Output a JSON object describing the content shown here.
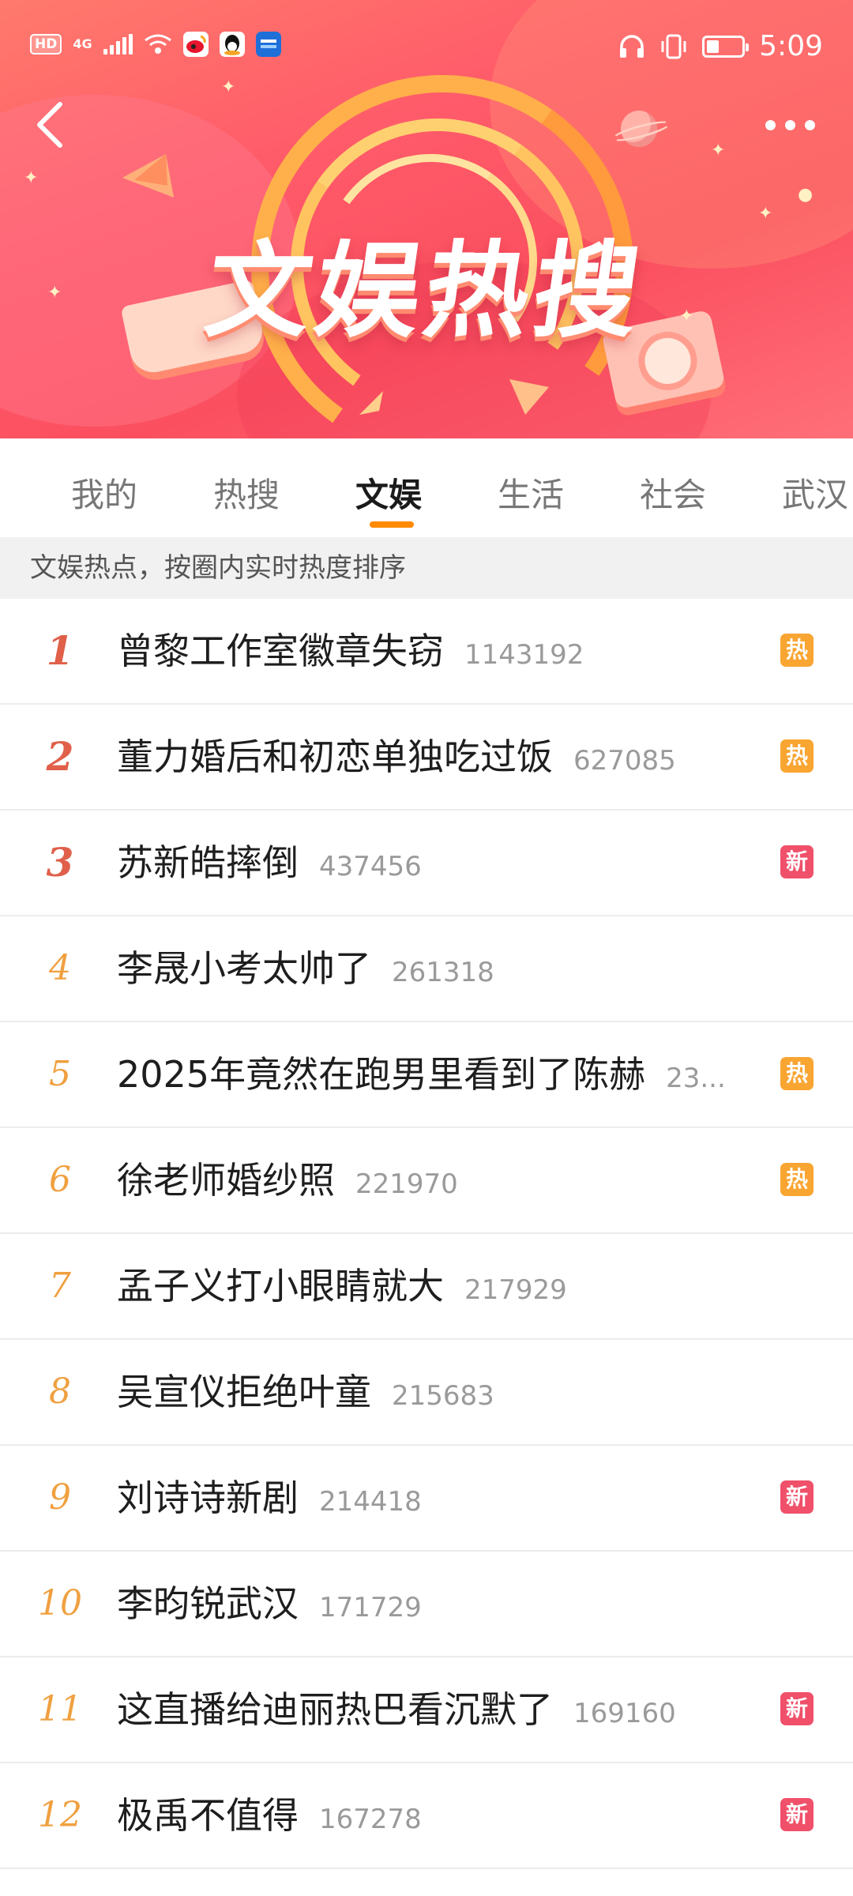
{
  "status_bar": {
    "hd": "HD",
    "network": "4G",
    "time": "5:09",
    "battery_level": 0.35
  },
  "banner": {
    "title": "文娱热搜"
  },
  "tabs": [
    {
      "label": "我的",
      "active": false
    },
    {
      "label": "热搜",
      "active": false
    },
    {
      "label": "文娱",
      "active": true
    },
    {
      "label": "生活",
      "active": false
    },
    {
      "label": "社会",
      "active": false
    },
    {
      "label": "武汉",
      "active": false
    }
  ],
  "subtitle": "文娱热点，按圈内实时热度排序",
  "items": [
    {
      "rank": "1",
      "title": "曾黎工作室徽章失窃",
      "heat": "1143192",
      "badge": "热"
    },
    {
      "rank": "2",
      "title": "董力婚后和初恋单独吃过饭",
      "heat": "627085",
      "badge": "热"
    },
    {
      "rank": "3",
      "title": "苏新皓摔倒",
      "heat": "437456",
      "badge": "新"
    },
    {
      "rank": "4",
      "title": "李晟小考太帅了",
      "heat": "261318",
      "badge": ""
    },
    {
      "rank": "5",
      "title": "2025年竟然在跑男里看到了陈赫",
      "heat": "23...",
      "badge": "热"
    },
    {
      "rank": "6",
      "title": "徐老师婚纱照",
      "heat": "221970",
      "badge": "热"
    },
    {
      "rank": "7",
      "title": "孟子义打小眼睛就大",
      "heat": "217929",
      "badge": ""
    },
    {
      "rank": "8",
      "title": "吴宣仪拒绝叶童",
      "heat": "215683",
      "badge": ""
    },
    {
      "rank": "9",
      "title": "刘诗诗新剧",
      "heat": "214418",
      "badge": "新"
    },
    {
      "rank": "10",
      "title": "李昀锐武汉",
      "heat": "171729",
      "badge": ""
    },
    {
      "rank": "11",
      "title": "这直播给迪丽热巴看沉默了",
      "heat": "169160",
      "badge": "新"
    },
    {
      "rank": "12",
      "title": "极禹不值得",
      "heat": "167278",
      "badge": "新"
    }
  ],
  "colors": {
    "accent": "#ff8a00",
    "badge_hot": "#f9a532",
    "badge_new": "#f0506a",
    "rank_top": "#e0604a",
    "rank_other": "#f0a040"
  }
}
